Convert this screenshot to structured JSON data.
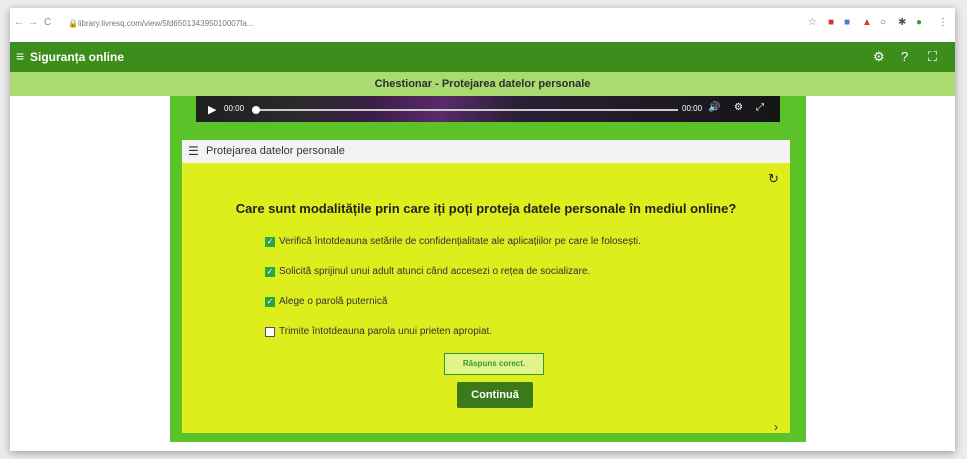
{
  "browser": {
    "url": "library.livresq.com/view/5fd650134395010007fa...",
    "nav_back": "←",
    "nav_forward": "→",
    "nav_reload": "C",
    "lock": "🔒",
    "ext_star": "☆",
    "ext_1": "■",
    "ext_2": "■",
    "ext_3": "▲",
    "ext_4": "○",
    "ext_5": "✱",
    "ext_6": "●",
    "ext_menu": "⋮"
  },
  "app": {
    "menu_icon": "≡",
    "title": "Siguranța online",
    "settings_icon": "⚙",
    "help_icon": "?",
    "fullscreen_icon": "⛶"
  },
  "subheader": {
    "title": "Chestionar - Protejarea datelor personale"
  },
  "video": {
    "play_icon": "▶",
    "time_current": "00:00",
    "time_total": "00:00",
    "volume_icon": "🔊",
    "settings_icon": "⚙",
    "fullscreen_icon": "⤢"
  },
  "panel": {
    "list_icon": "☰",
    "title": "Protejarea datelor personale",
    "reset_icon": "↻",
    "question": "Care sunt modalitățile prin care iți poți proteja datele personale în mediul online?",
    "options": [
      {
        "label": "Verifică întotdeauna setările de confidențialitate ale aplicațiilor pe care le folosești.",
        "checked": true
      },
      {
        "label": "Solicită sprijinul unui adult atunci când accesezi o rețea de socializare.",
        "checked": true
      },
      {
        "label": "Alege o parolă puternică",
        "checked": true
      },
      {
        "label": "Trimite întotdeauna parola unui prieten apropiat.",
        "checked": false
      }
    ],
    "feedback": "Răspuns corect.",
    "continue_label": "Continuă",
    "next_icon": "›"
  },
  "colors": {
    "header_green": "#3c8d1c",
    "subheader_green": "#a8dc70",
    "content_green": "#5bc22a",
    "quiz_yellow": "#ddee1c",
    "check_green": "#28a745",
    "button_green": "#3a7a1a"
  }
}
